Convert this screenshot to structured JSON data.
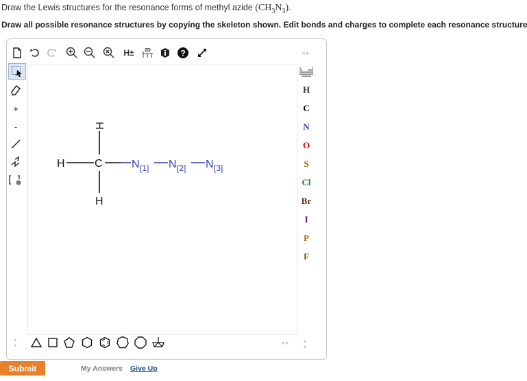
{
  "question": {
    "line1_prefix": "Draw the Lewis structures for the resonance forms of methyl azide ",
    "formula": "(CH3N3)",
    "line1_suffix": ".",
    "line2": "Draw all possible resonance structures by copying the skeleton shown. Edit bonds and charges to complete each resonance structure."
  },
  "toolbar": {
    "h_toggle": "H±",
    "twod_label": "2D"
  },
  "atoms_panel": {
    "elements": [
      {
        "symbol": "H",
        "color": "#333333"
      },
      {
        "symbol": "C",
        "color": "#000000"
      },
      {
        "symbol": "N",
        "color": "#2a3fb0"
      },
      {
        "symbol": "O",
        "color": "#e00000"
      },
      {
        "symbol": "S",
        "color": "#8a6a00"
      },
      {
        "symbol": "Cl",
        "color": "#1a8a1a"
      },
      {
        "symbol": "Br",
        "color": "#6b2b10"
      },
      {
        "symbol": "I",
        "color": "#5a0c86"
      },
      {
        "symbol": "P",
        "color": "#b06a00"
      },
      {
        "symbol": "F",
        "color": "#7a6010"
      }
    ]
  },
  "molecule": {
    "atom_labels": {
      "h_left": "H",
      "h_top": "H",
      "h_bottom": "H",
      "carbon": "C",
      "n1": "N",
      "n1_map": "[1]",
      "n2": "N",
      "n2_map": "[2]",
      "n3": "N",
      "n3_map": "[3]"
    }
  },
  "actions": {
    "submit": "Submit",
    "my_answers": "My Answers",
    "give_up": "Give Up"
  }
}
